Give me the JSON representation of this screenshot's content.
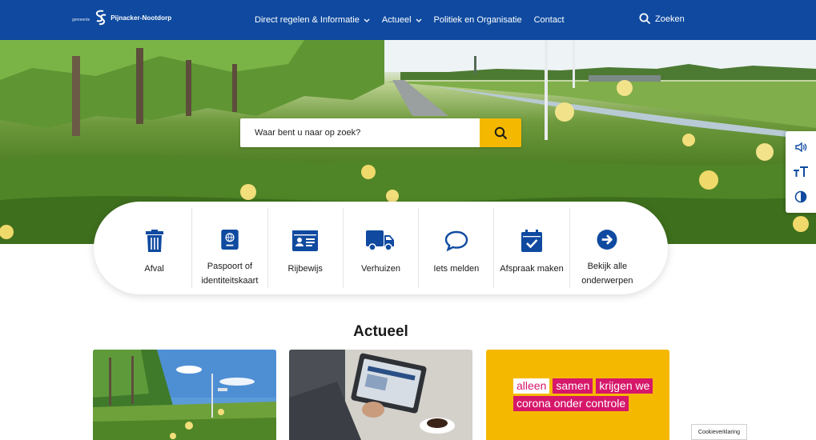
{
  "header": {
    "logo": {
      "prefix": "gemeente",
      "name": "Pijnacker-Nootdorp"
    },
    "nav": [
      {
        "label": "Direct regelen & Informatie",
        "dropdown": true
      },
      {
        "label": "Actueel",
        "dropdown": true
      },
      {
        "label": "Politiek en Organisatie",
        "dropdown": false
      },
      {
        "label": "Contact",
        "dropdown": false
      }
    ],
    "search_label": "Zoeken"
  },
  "hero": {
    "search_placeholder": "Waar bent u naar op zoek?"
  },
  "quick_links": [
    {
      "label": "Afval",
      "icon": "trash-icon"
    },
    {
      "label": "Paspoort of identiteitskaart",
      "icon": "passport-icon"
    },
    {
      "label": "Rijbewijs",
      "icon": "id-card-icon"
    },
    {
      "label": "Verhuizen",
      "icon": "truck-icon"
    },
    {
      "label": "Iets melden",
      "icon": "speech-bubble-icon"
    },
    {
      "label": "Afspraak maken",
      "icon": "calendar-check-icon"
    },
    {
      "label": "Bekijk alle onderwerpen",
      "icon": "arrow-right-circle-icon"
    }
  ],
  "actueel": {
    "title": "Actueel",
    "slogan_lines": [
      [
        {
          "text": "alleen",
          "style": "white"
        },
        {
          "text": "samen",
          "style": "pink"
        },
        {
          "text": "krijgen we",
          "style": "pink"
        }
      ],
      [
        {
          "text": "corona onder controle",
          "style": "pink"
        }
      ]
    ]
  },
  "cookie_label": "Cookieverklaring",
  "colors": {
    "brand_blue": "#0f4aa0",
    "accent_yellow": "#f5b800",
    "slogan_pink": "#d6176a"
  }
}
